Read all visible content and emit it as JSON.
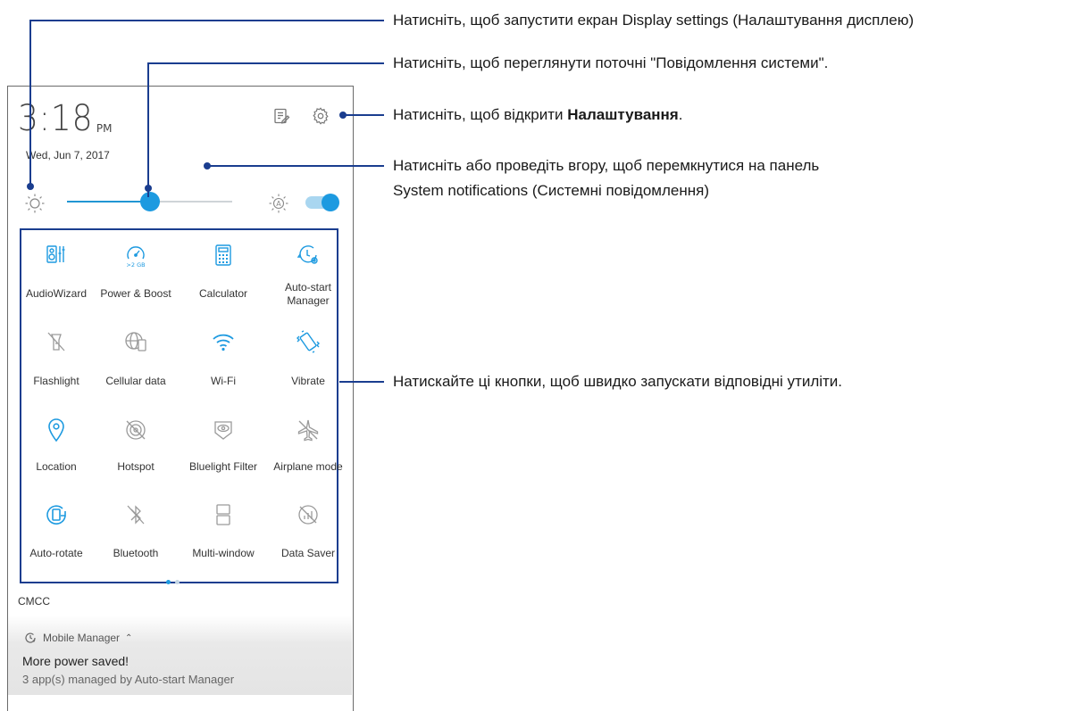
{
  "status": {
    "time": "3:18",
    "ampm": "PM",
    "date": "Wed, Jun 7, 2017"
  },
  "brightness": {
    "level": 0.5,
    "auto": true
  },
  "tiles": [
    {
      "label": "AudioWizard",
      "icon": "audiowizard-icon",
      "active": true
    },
    {
      "label": "Power & Boost",
      "sub": ">2 GB",
      "icon": "power-boost-icon",
      "active": true
    },
    {
      "label": "Calculator",
      "icon": "calculator-icon",
      "active": true
    },
    {
      "label": "Auto-start Manager",
      "icon": "auto-start-manager-icon",
      "active": true
    },
    {
      "label": "Flashlight",
      "icon": "flashlight-icon",
      "active": false
    },
    {
      "label": "Cellular data",
      "icon": "cellular-data-icon",
      "active": false
    },
    {
      "label": "Wi-Fi",
      "icon": "wifi-icon",
      "active": true
    },
    {
      "label": "Vibrate",
      "icon": "vibrate-icon",
      "active": true
    },
    {
      "label": "Location",
      "icon": "location-icon",
      "active": true
    },
    {
      "label": "Hotspot",
      "icon": "hotspot-icon",
      "active": false
    },
    {
      "label": "Bluelight Filter",
      "icon": "bluelight-filter-icon",
      "active": false
    },
    {
      "label": "Airplane mode",
      "icon": "airplane-icon",
      "active": false
    },
    {
      "label": "Auto-rotate",
      "icon": "auto-rotate-icon",
      "active": true
    },
    {
      "label": "Bluetooth",
      "icon": "bluetooth-icon",
      "active": false
    },
    {
      "label": "Multi-window",
      "icon": "multi-window-icon",
      "active": false
    },
    {
      "label": "Data Saver",
      "icon": "data-saver-icon",
      "active": false
    }
  ],
  "carrier": "CMCC",
  "notification": {
    "app": "Mobile Manager",
    "title": "More power saved!",
    "body": "3 app(s) managed by Auto-start Manager"
  },
  "callouts": {
    "display_settings": "Натисніть, щоб запустити екран Display settings (Налаштування дисплею)",
    "system_notifications": "Натисніть, щоб переглянути поточні \"Повідомлення системи\".",
    "settings_prefix": "Натисніть, щоб відкрити ",
    "settings_bold": "Налаштування",
    "settings_suffix": ".",
    "swipe_line1": "Натисніть або проведіть вгору, щоб перемкнутися на панель",
    "swipe_line2": "System notifications (Системні повідомлення)",
    "quick_tiles": "Натискайте ці кнопки, щоб швидко запускати відповідні утиліти."
  },
  "colors": {
    "accent": "#1d9ae0",
    "callout_line": "#1a3d8f",
    "inactive_icon": "#9a9a9a"
  }
}
